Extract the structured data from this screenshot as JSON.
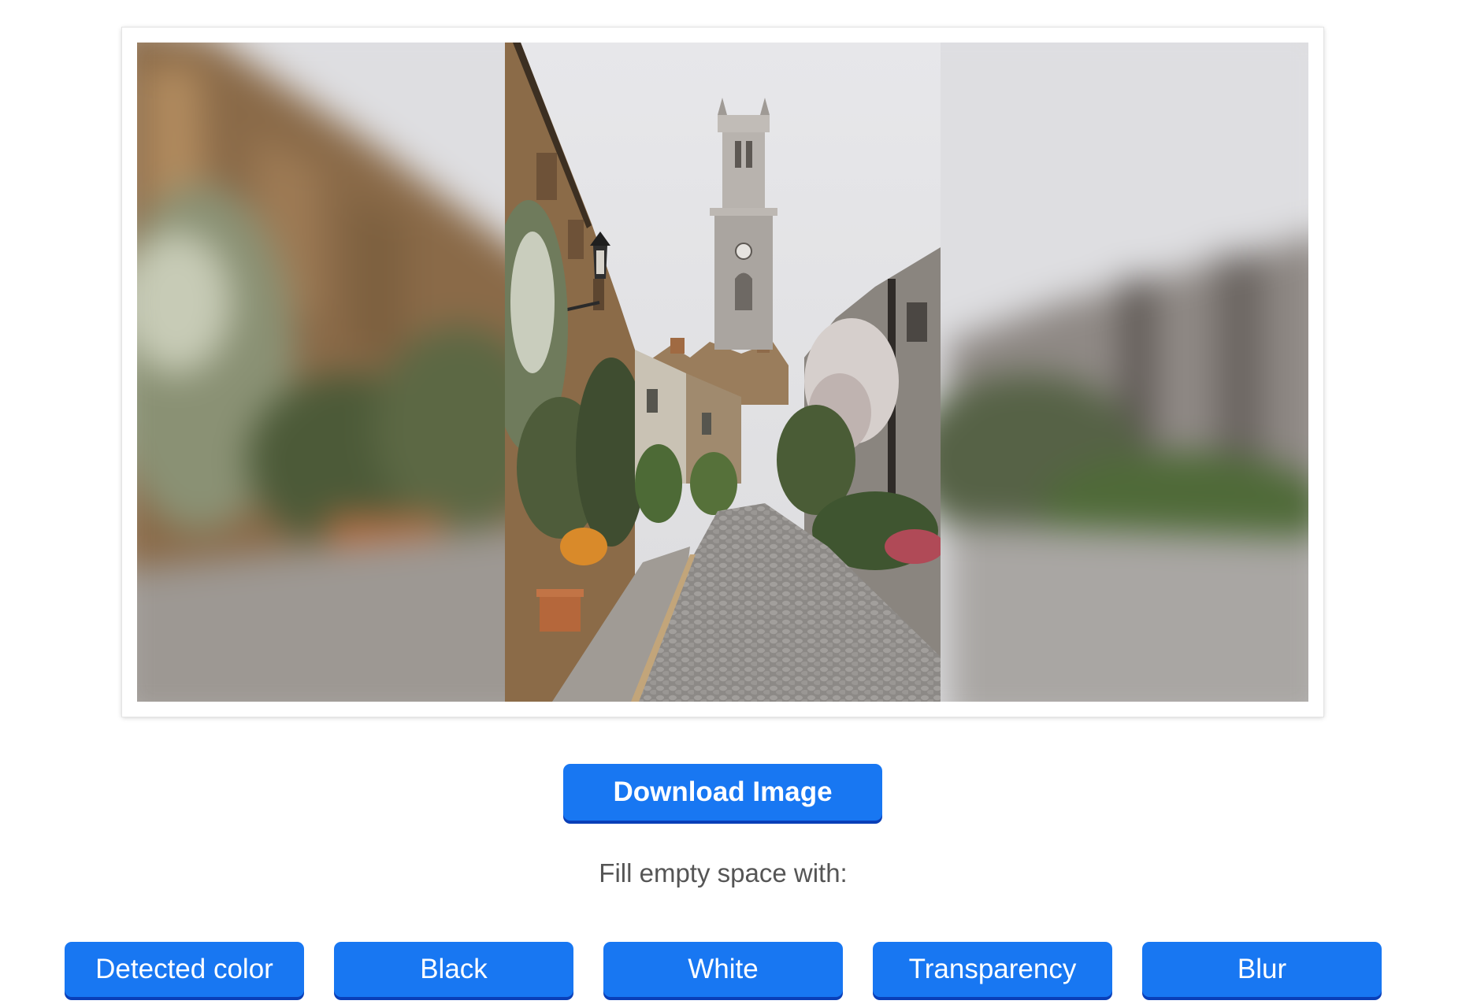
{
  "preview": {
    "image_description": "Cobblestone lane between stone terraced houses with flowering shrubs, leading to a church clock tower; the centered photo is flanked by a blurred fill on both sides"
  },
  "actions": {
    "download_label": "Download Image"
  },
  "fill": {
    "prompt": "Fill empty space with:",
    "options": [
      "Detected color",
      "Black",
      "White",
      "Transparency",
      "Blur"
    ]
  },
  "colors": {
    "accent": "#1877f2",
    "accent_shadow": "#0a3fb8",
    "label_text": "#555555"
  }
}
